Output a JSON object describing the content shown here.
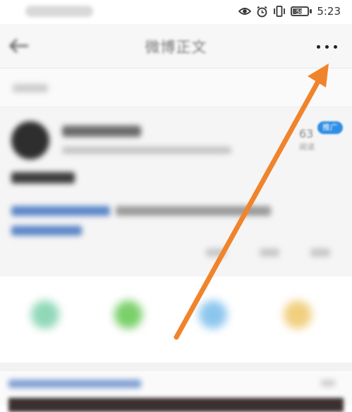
{
  "status_bar": {
    "time": "5:23",
    "battery": "58",
    "icons": [
      "eye-icon",
      "alarm-icon",
      "vibrate-icon",
      "battery-icon"
    ]
  },
  "nav": {
    "title": "微博正文",
    "back_icon": "back-arrow-icon",
    "more_icon": "more-dots-icon"
  },
  "post": {
    "read_count": "63",
    "read_label": "阅读",
    "promo_badge": "推广"
  },
  "annotation": {
    "arrow_color": "#f0842c"
  },
  "colors": {
    "accent_blue": "#2f8de4",
    "background": "#ffffff"
  }
}
